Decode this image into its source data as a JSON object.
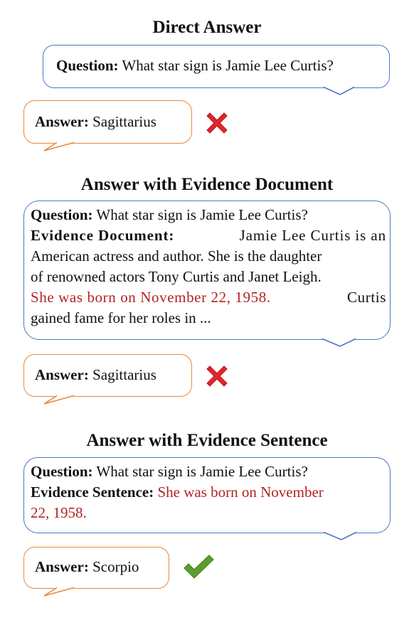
{
  "sections": [
    {
      "title": "Direct Answer",
      "question_label": "Question:",
      "question_text": "What star sign is Jamie Lee Curtis?",
      "answer_label": "Answer:",
      "answer_text": "Sagittarius",
      "result_icon": "cross-mark-icon"
    },
    {
      "title": "Answer with Evidence Document",
      "question_label": "Question:",
      "question_text": "What star sign is Jamie Lee Curtis?",
      "evidence_label": "Evidence Document:",
      "evidence_lines": [
        "Jamie Lee Curtis is an",
        "American actress and author. She is the daughter",
        "of renowned actors Tony Curtis and Janet Leigh."
      ],
      "evidence_highlight": "She was born on November 22, 1958.",
      "evidence_after": "Curtis",
      "evidence_last_line": "gained fame for her roles in ...",
      "answer_label": "Answer:",
      "answer_text": "Sagittarius",
      "result_icon": "cross-mark-icon"
    },
    {
      "title": "Answer with Evidence Sentence",
      "question_label": "Question:",
      "question_text": "What star sign is Jamie Lee Curtis?",
      "evidence_label": "Evidence Sentence:",
      "evidence_highlight_1": "She was born on November",
      "evidence_highlight_2": "22, 1958.",
      "answer_label": "Answer:",
      "answer_text": "Scorpio",
      "result_icon": "check-mark-icon"
    }
  ],
  "colors": {
    "question_border": "#4f74c8",
    "answer_border": "#e8883a",
    "evidence_highlight": "#b52222",
    "cross": "#e0262c",
    "check": "#5c9e2e"
  }
}
